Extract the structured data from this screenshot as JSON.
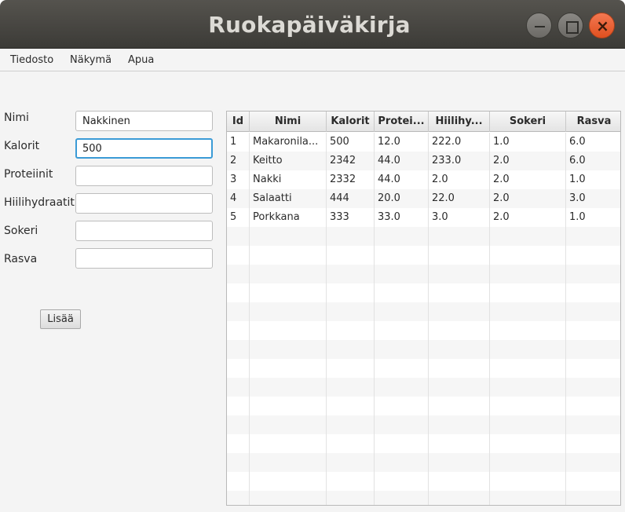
{
  "window": {
    "title": "Ruokapäiväkirja",
    "close_glyph": "×"
  },
  "menu": [
    "Tiedosto",
    "Näkymä",
    "Apua"
  ],
  "form": {
    "fields": [
      {
        "label": "Nimi",
        "value": "Nakkinen"
      },
      {
        "label": "Kalorit",
        "value": "500"
      },
      {
        "label": "Proteiinit",
        "value": ""
      },
      {
        "label": "Hiilihydraatit",
        "value": ""
      },
      {
        "label": "Sokeri",
        "value": ""
      },
      {
        "label": "Rasva",
        "value": ""
      }
    ],
    "add_button": "Lisää"
  },
  "table": {
    "headers": [
      "Id",
      "Nimi",
      "Kalorit",
      "Protei...",
      "Hiilihy...",
      "Sokeri",
      "Rasva"
    ],
    "rows": [
      [
        "1",
        "Makaronila...",
        "500",
        "12.0",
        "222.0",
        "1.0",
        "6.0"
      ],
      [
        "2",
        "Keitto",
        "2342",
        "44.0",
        "233.0",
        "2.0",
        "6.0"
      ],
      [
        "3",
        "Nakki",
        "2332",
        "44.0",
        "2.0",
        "2.0",
        "1.0"
      ],
      [
        "4",
        "Salaatti",
        "444",
        "20.0",
        "22.0",
        "2.0",
        "3.0"
      ],
      [
        "5",
        "Porkkana",
        "333",
        "33.0",
        "3.0",
        "2.0",
        "1.0"
      ]
    ]
  },
  "colors": {
    "titlebar": "#3c3b37",
    "close_button": "#e95420",
    "focus_border": "#3b9bd6"
  }
}
